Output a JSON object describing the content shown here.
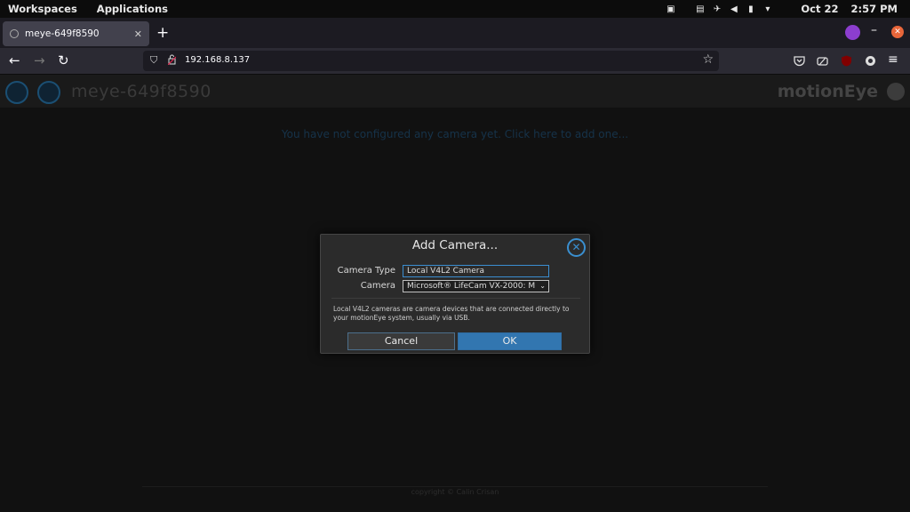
{
  "topbar": {
    "workspaces": "Workspaces",
    "applications": "Applications",
    "date": "Oct 22",
    "time": "2:57 PM",
    "tray_icons": [
      "screenshare-icon",
      "dashboard-icon",
      "airplane-icon",
      "volume-icon",
      "battery-icon",
      "chevron-down-icon"
    ]
  },
  "browser": {
    "tab_title": "meye-649f8590",
    "url": "192.168.8.137",
    "extension_color": "#8c3ecf",
    "close_color": "#e8663a"
  },
  "motioneye": {
    "hostname": "meye-649f8590",
    "brand": "motionEye",
    "no_camera_message": "You have not configured any camera yet. Click here to add one...",
    "footer": "copyright © Calin Crisan"
  },
  "dialog": {
    "title": "Add Camera...",
    "camera_type_label": "Camera Type",
    "camera_type_value": "Local V4L2 Camera",
    "camera_label": "Camera",
    "camera_value": "Microsoft® LifeCam VX-2000: M",
    "description": "Local V4L2 cameras are camera devices that are connected directly to your motionEye system, usually via USB.",
    "cancel_label": "Cancel",
    "ok_label": "OK",
    "accent_color": "#3276b0"
  }
}
